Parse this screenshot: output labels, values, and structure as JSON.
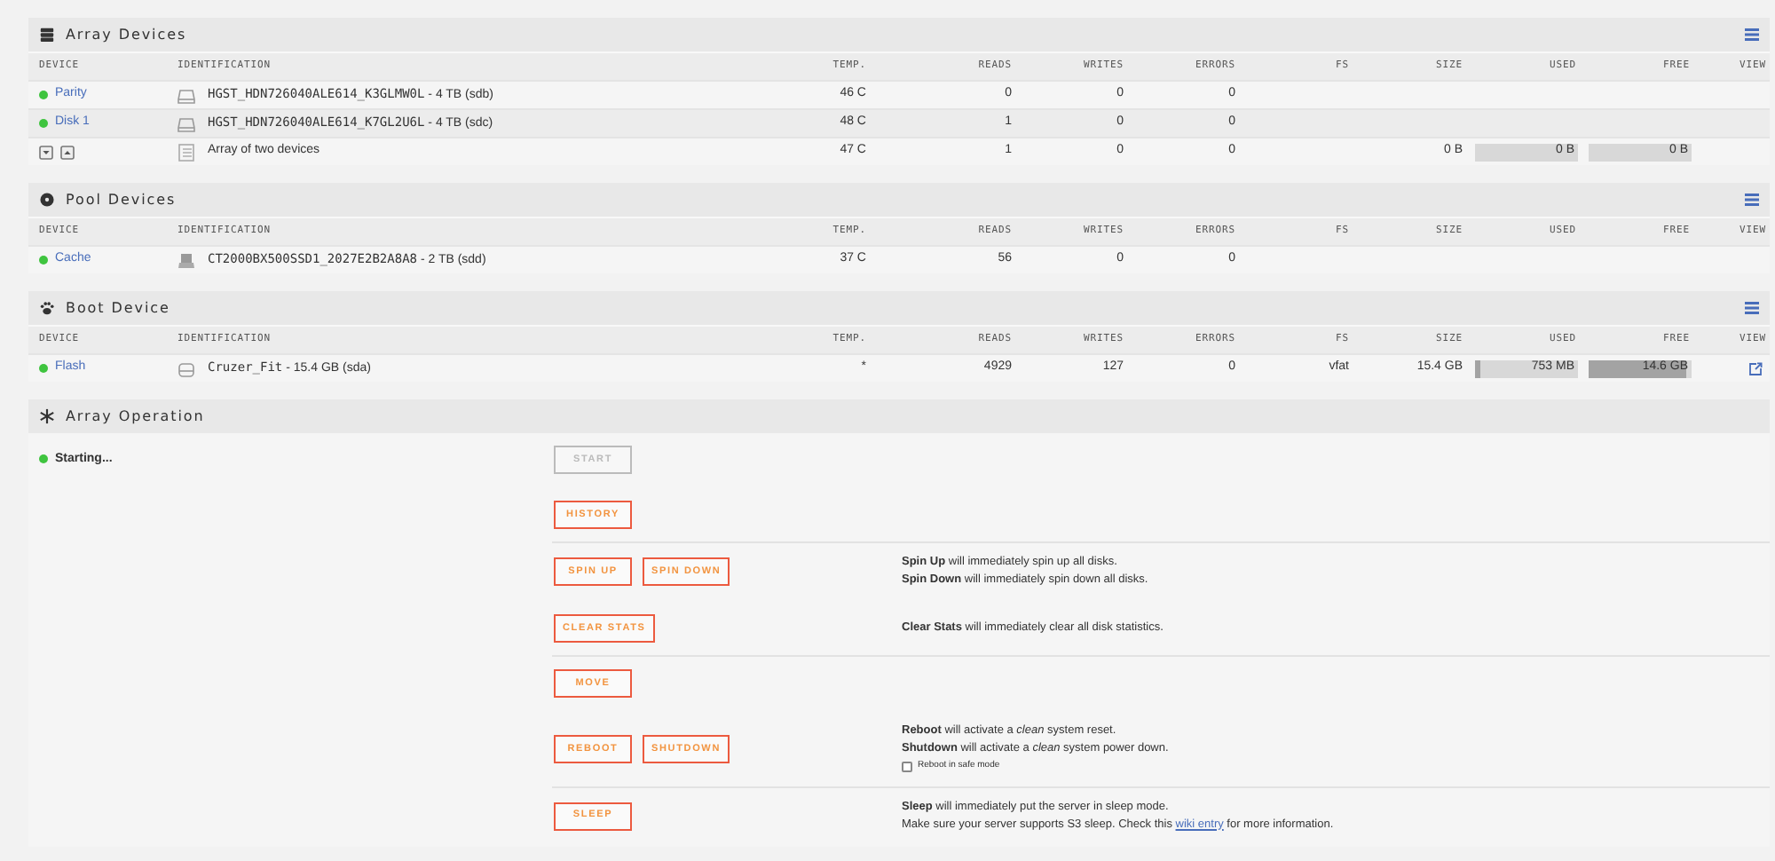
{
  "device_sections": [
    {
      "title": "Array Devices",
      "columns": [
        "DEVICE",
        "IDENTIFICATION",
        "TEMP.",
        "READS",
        "WRITES",
        "ERRORS",
        "FS",
        "SIZE",
        "USED",
        "FREE",
        "VIEW"
      ],
      "rows": [
        {
          "kind": "hdd",
          "name": "Parity",
          "color": "#3fc43f",
          "identification": "HGST_HDN726040ALE614_K3GLMW0L",
          "suffix": " - 4 TB (sdb)",
          "temp": "46 C",
          "reads": "0",
          "writes": "0",
          "errors": "0"
        },
        {
          "kind": "hdd",
          "name": "Disk 1",
          "color": "#3fc43f",
          "identification": "HGST_HDN726040ALE614_K7GL2U6L",
          "suffix": " - 4 TB (sdc)",
          "temp": "48 C",
          "reads": "1",
          "writes": "0",
          "errors": "0"
        },
        {
          "kind": "array",
          "identification": "Array of two devices",
          "temp": "47 C",
          "reads": "1",
          "writes": "0",
          "errors": "0",
          "size": "0 B",
          "used": {
            "text": "0 B",
            "level": 0
          },
          "free": {
            "text": "0 B",
            "level": 0
          }
        }
      ]
    },
    {
      "title": "Pool Devices",
      "columns": [
        "DEVICE",
        "IDENTIFICATION",
        "TEMP.",
        "READS",
        "WRITES",
        "ERRORS",
        "FS",
        "SIZE",
        "USED",
        "FREE",
        "VIEW"
      ],
      "rows": [
        {
          "kind": "ssd",
          "name": "Cache",
          "color": "#3fc43f",
          "identification": "CT2000BX500SSD1_2027E2B2A8A8",
          "suffix": " - 2 TB (sdd)",
          "temp": "37 C",
          "reads": "56",
          "writes": "0",
          "errors": "0"
        }
      ]
    },
    {
      "title": "Boot Device",
      "columns": [
        "DEVICE",
        "IDENTIFICATION",
        "TEMP.",
        "READS",
        "WRITES",
        "ERRORS",
        "FS",
        "SIZE",
        "USED",
        "FREE",
        "VIEW"
      ],
      "rows": [
        {
          "kind": "usb",
          "name": "Flash",
          "color": "#3fc43f",
          "identification": "Cruzer_Fit",
          "suffix": " - 15.4 GB (sda)",
          "temp": "*",
          "reads": "4929",
          "writes": "127",
          "errors": "0",
          "fs": "vfat",
          "size": "15.4 GB",
          "used": {
            "text": "753 MB",
            "level": 0.05
          },
          "free": {
            "text": "14.6 GB",
            "level": 0.95
          },
          "view": true
        }
      ]
    }
  ],
  "operation": {
    "title": "Array Operation",
    "status": {
      "text": "Starting...",
      "color": "#3fc43f"
    },
    "groups": [
      [
        {
          "buttons": [
            {
              "label": "START",
              "disabled": true
            }
          ]
        },
        {
          "buttons": [
            {
              "label": "HISTORY",
              "disabled": false
            }
          ]
        }
      ],
      [
        {
          "buttons": [
            {
              "label": "SPIN UP",
              "disabled": false
            },
            {
              "label": "SPIN DOWN",
              "disabled": false
            }
          ],
          "lines": [
            {
              "text": "**Spin Up** will immediately spin up all disks."
            },
            {
              "text": "**Spin Down** will immediately spin down all disks."
            }
          ]
        },
        {
          "buttons": [
            {
              "label": "CLEAR STATS",
              "disabled": false
            }
          ],
          "lines": [
            {
              "text": "**Clear Stats** will immediately clear all disk statistics."
            }
          ]
        }
      ],
      [
        {
          "buttons": [
            {
              "label": "MOVE",
              "disabled": false
            }
          ]
        },
        {
          "buttons": [
            {
              "label": "REBOOT",
              "disabled": false
            },
            {
              "label": "SHUTDOWN",
              "disabled": false
            }
          ],
          "lines": [
            {
              "text": "**Reboot** will activate a *clean* system reset."
            },
            {
              "text": "**Shutdown** will activate a *clean* system power down."
            }
          ],
          "checkbox": {
            "label": "Reboot in safe mode",
            "checked": false
          }
        }
      ],
      [
        {
          "buttons": [
            {
              "label": "SLEEP",
              "disabled": false
            }
          ],
          "lines": [
            {
              "text": "**Sleep** will immediately put the server in sleep mode."
            },
            {
              "text": "Make sure your server supports S3 sleep. Check this ",
              "link": "wiki entry",
              "after": " for more information."
            }
          ]
        }
      ]
    ]
  }
}
